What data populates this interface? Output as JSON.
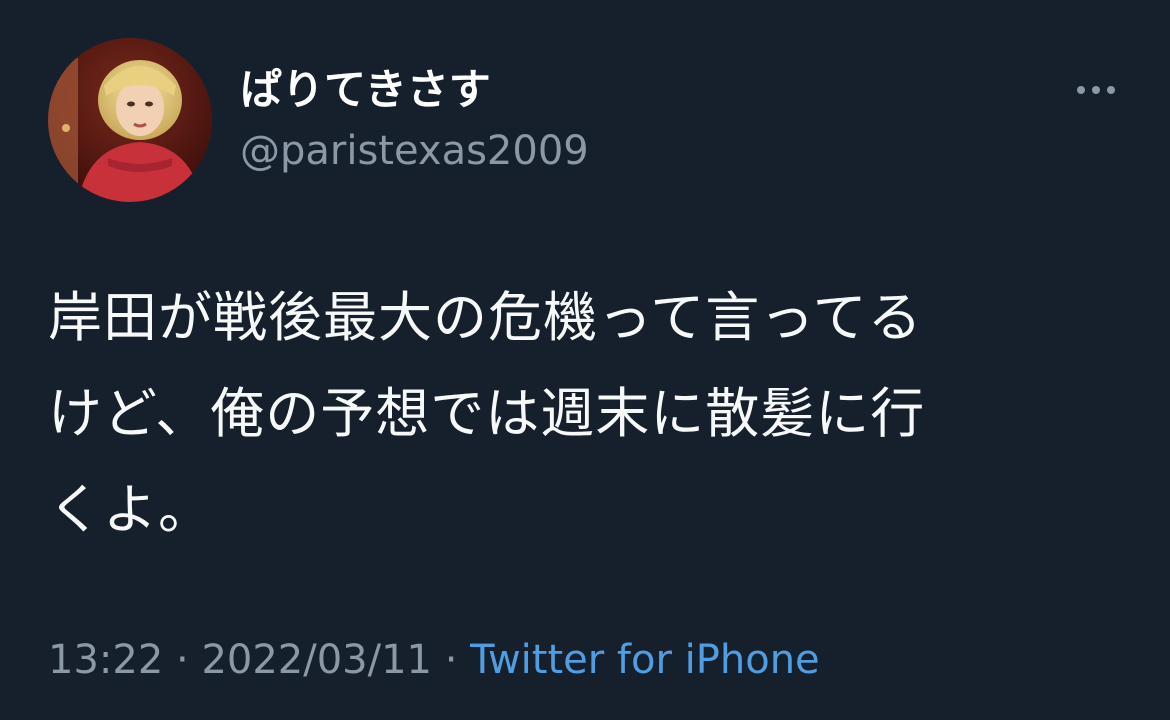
{
  "tweet": {
    "author": {
      "display_name": "ぱりてきさす",
      "handle": "@paristexas2009",
      "avatar_icon": "avatar-photo"
    },
    "more_icon": "more-horizontal-icon",
    "text_lines": [
      "岸田が戦後最大の危機って言ってる",
      "けど、俺の予想では週末に散髪に行",
      "くよ。"
    ],
    "time": "13:22",
    "separator": "·",
    "date": "2022/03/11",
    "source": "Twitter for iPhone"
  },
  "colors": {
    "background": "#16202c",
    "text": "#f7f9f9",
    "secondary_text": "#8b98a5",
    "link": "#4f9ee3"
  }
}
